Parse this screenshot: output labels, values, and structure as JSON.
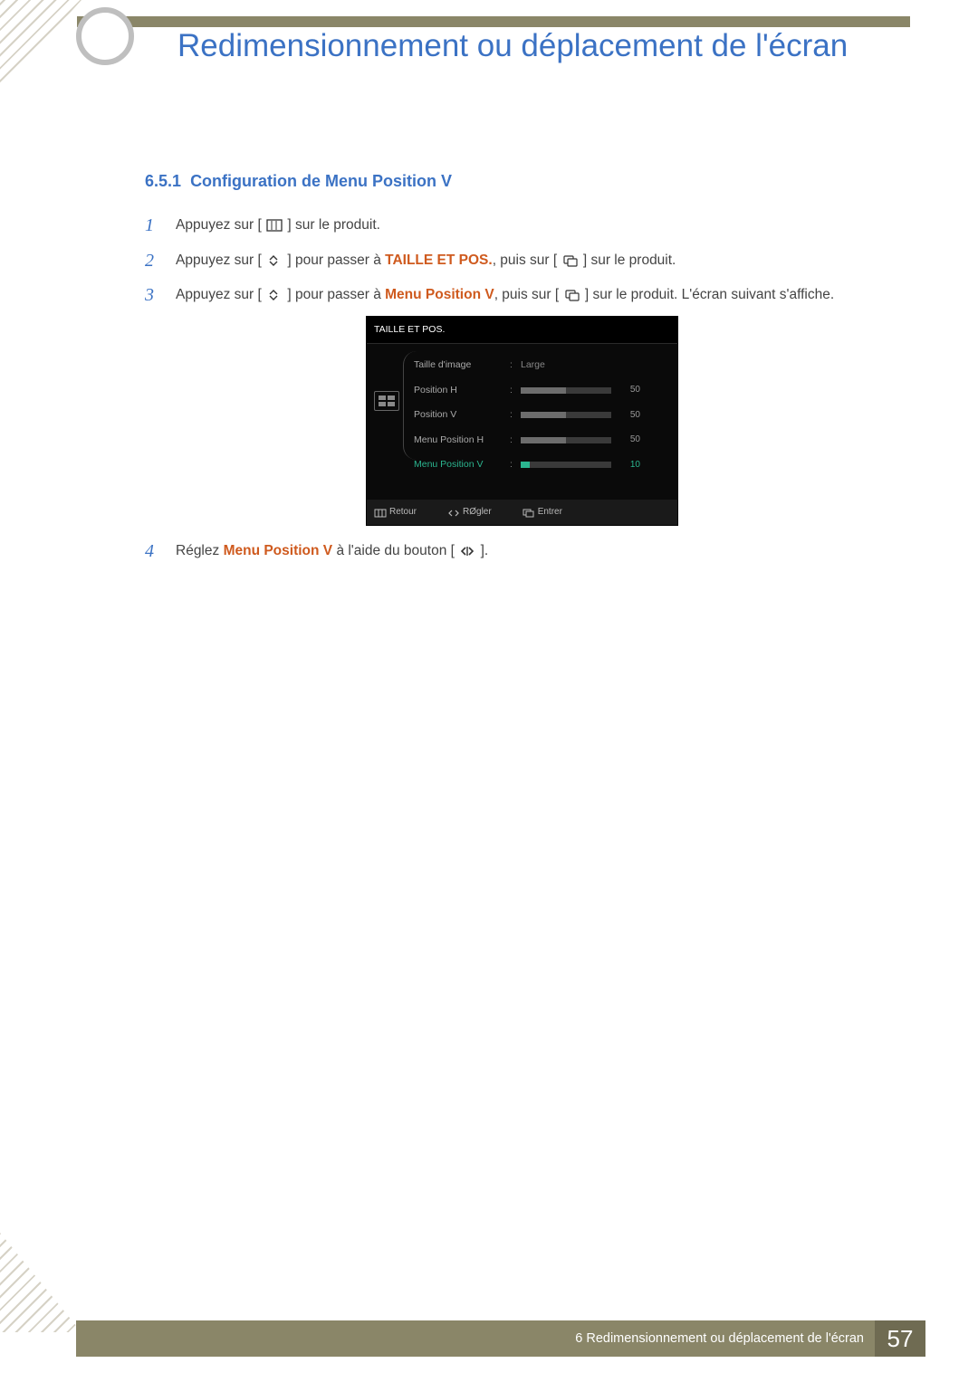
{
  "header": {
    "page_title": "Redimensionnement ou déplacement de l'écran"
  },
  "section": {
    "number": "6.5.1",
    "title": "Configuration de Menu Position V"
  },
  "steps": [
    {
      "pre": "Appuyez sur ",
      "post": " sur le produit."
    },
    {
      "pre": "Appuyez sur ",
      "mid": " pour passer à ",
      "term": "TAILLE ET POS.",
      "after_term": ", puis sur ",
      "post": " sur le produit."
    },
    {
      "pre": "Appuyez sur ",
      "mid": " pour passer à ",
      "term": "Menu Position V",
      "after_term": ", puis sur ",
      "post": " sur le produit. L'écran suivant s'affiche."
    },
    {
      "pre": "Réglez ",
      "term": "Menu Position V",
      "mid": " à l'aide du bouton ",
      "post": "."
    }
  ],
  "osd": {
    "title": "TAILLE ET POS.",
    "rows": [
      {
        "label": "Taille d'image",
        "value_text": "Large"
      },
      {
        "label": "Position H",
        "value": "50"
      },
      {
        "label": "Position V",
        "value": "50"
      },
      {
        "label": "Menu Position H",
        "value": "50"
      },
      {
        "label": "Menu Position V",
        "value": "10",
        "active": true
      }
    ],
    "footer": {
      "return": "Retour",
      "adjust": "RØgler",
      "enter": "Entrer"
    }
  },
  "footer": {
    "chapter_label": "6 Redimensionnement ou déplacement de l'écran",
    "page_number": "57"
  }
}
